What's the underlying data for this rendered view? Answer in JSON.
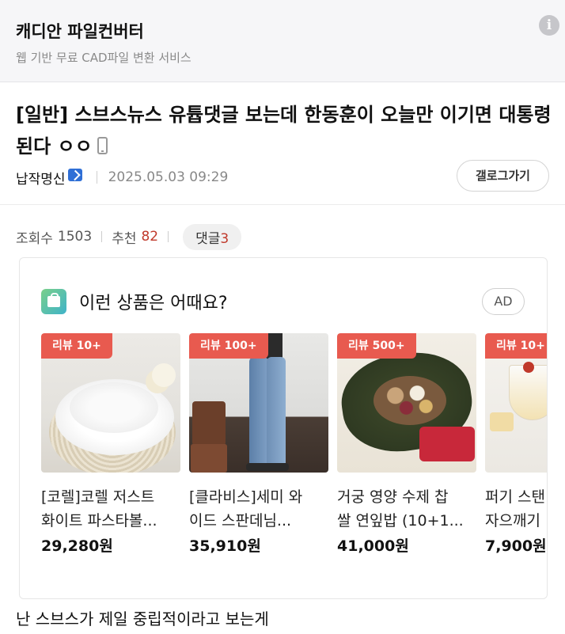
{
  "topbar": {
    "title": "캐디안 파일컨버터",
    "subtitle": "웹 기반 무료 CAD파일 변환 서비스",
    "info_icon": "info-icon"
  },
  "post": {
    "title": "[일반] 스브스뉴스 유튭댓글 보는데 한동훈이 오늘만 이기면 대통령된다 ㅇㅇ",
    "device_icon": "mobile-phone-icon",
    "author": "납작명신",
    "author_badge_icon": "verified-badge-icon",
    "date": "2025.05.03 09:29",
    "gallery_button": "갤로그가기",
    "stats": {
      "views_label": "조회수",
      "views": "1503",
      "recommend_label": "추천",
      "recommend": "82",
      "comments_label": "댓글",
      "comments": "3"
    },
    "body_first_line": "난 스브스가 제일 중립적이라고 보는게"
  },
  "ad": {
    "heading": "이런 상품은 어때요?",
    "tag": "AD",
    "products": [
      {
        "badge": "리뷰 10+",
        "name_line1": "[코렐]코렐 저스트",
        "name_line2": "화이트 파스타볼...",
        "price": "29,280원"
      },
      {
        "badge": "리뷰 100+",
        "name_line1": "[클라비스]세미 와",
        "name_line2": "이드 스판데님...",
        "price": "35,910원"
      },
      {
        "badge": "리뷰 500+",
        "name_line1": "거궁 영양 수제 찹",
        "name_line2": "쌀 연잎밥 (10+1...",
        "price": "41,000원"
      },
      {
        "badge": "리뷰 10+",
        "name_line1": "퍼기 스탠",
        "name_line2": "자으깨기",
        "price": "7,900원"
      }
    ]
  },
  "colors": {
    "badge_red": "#e85a4f",
    "recommend_red": "#c0392b",
    "topbar_bg": "#f6f6f8"
  }
}
